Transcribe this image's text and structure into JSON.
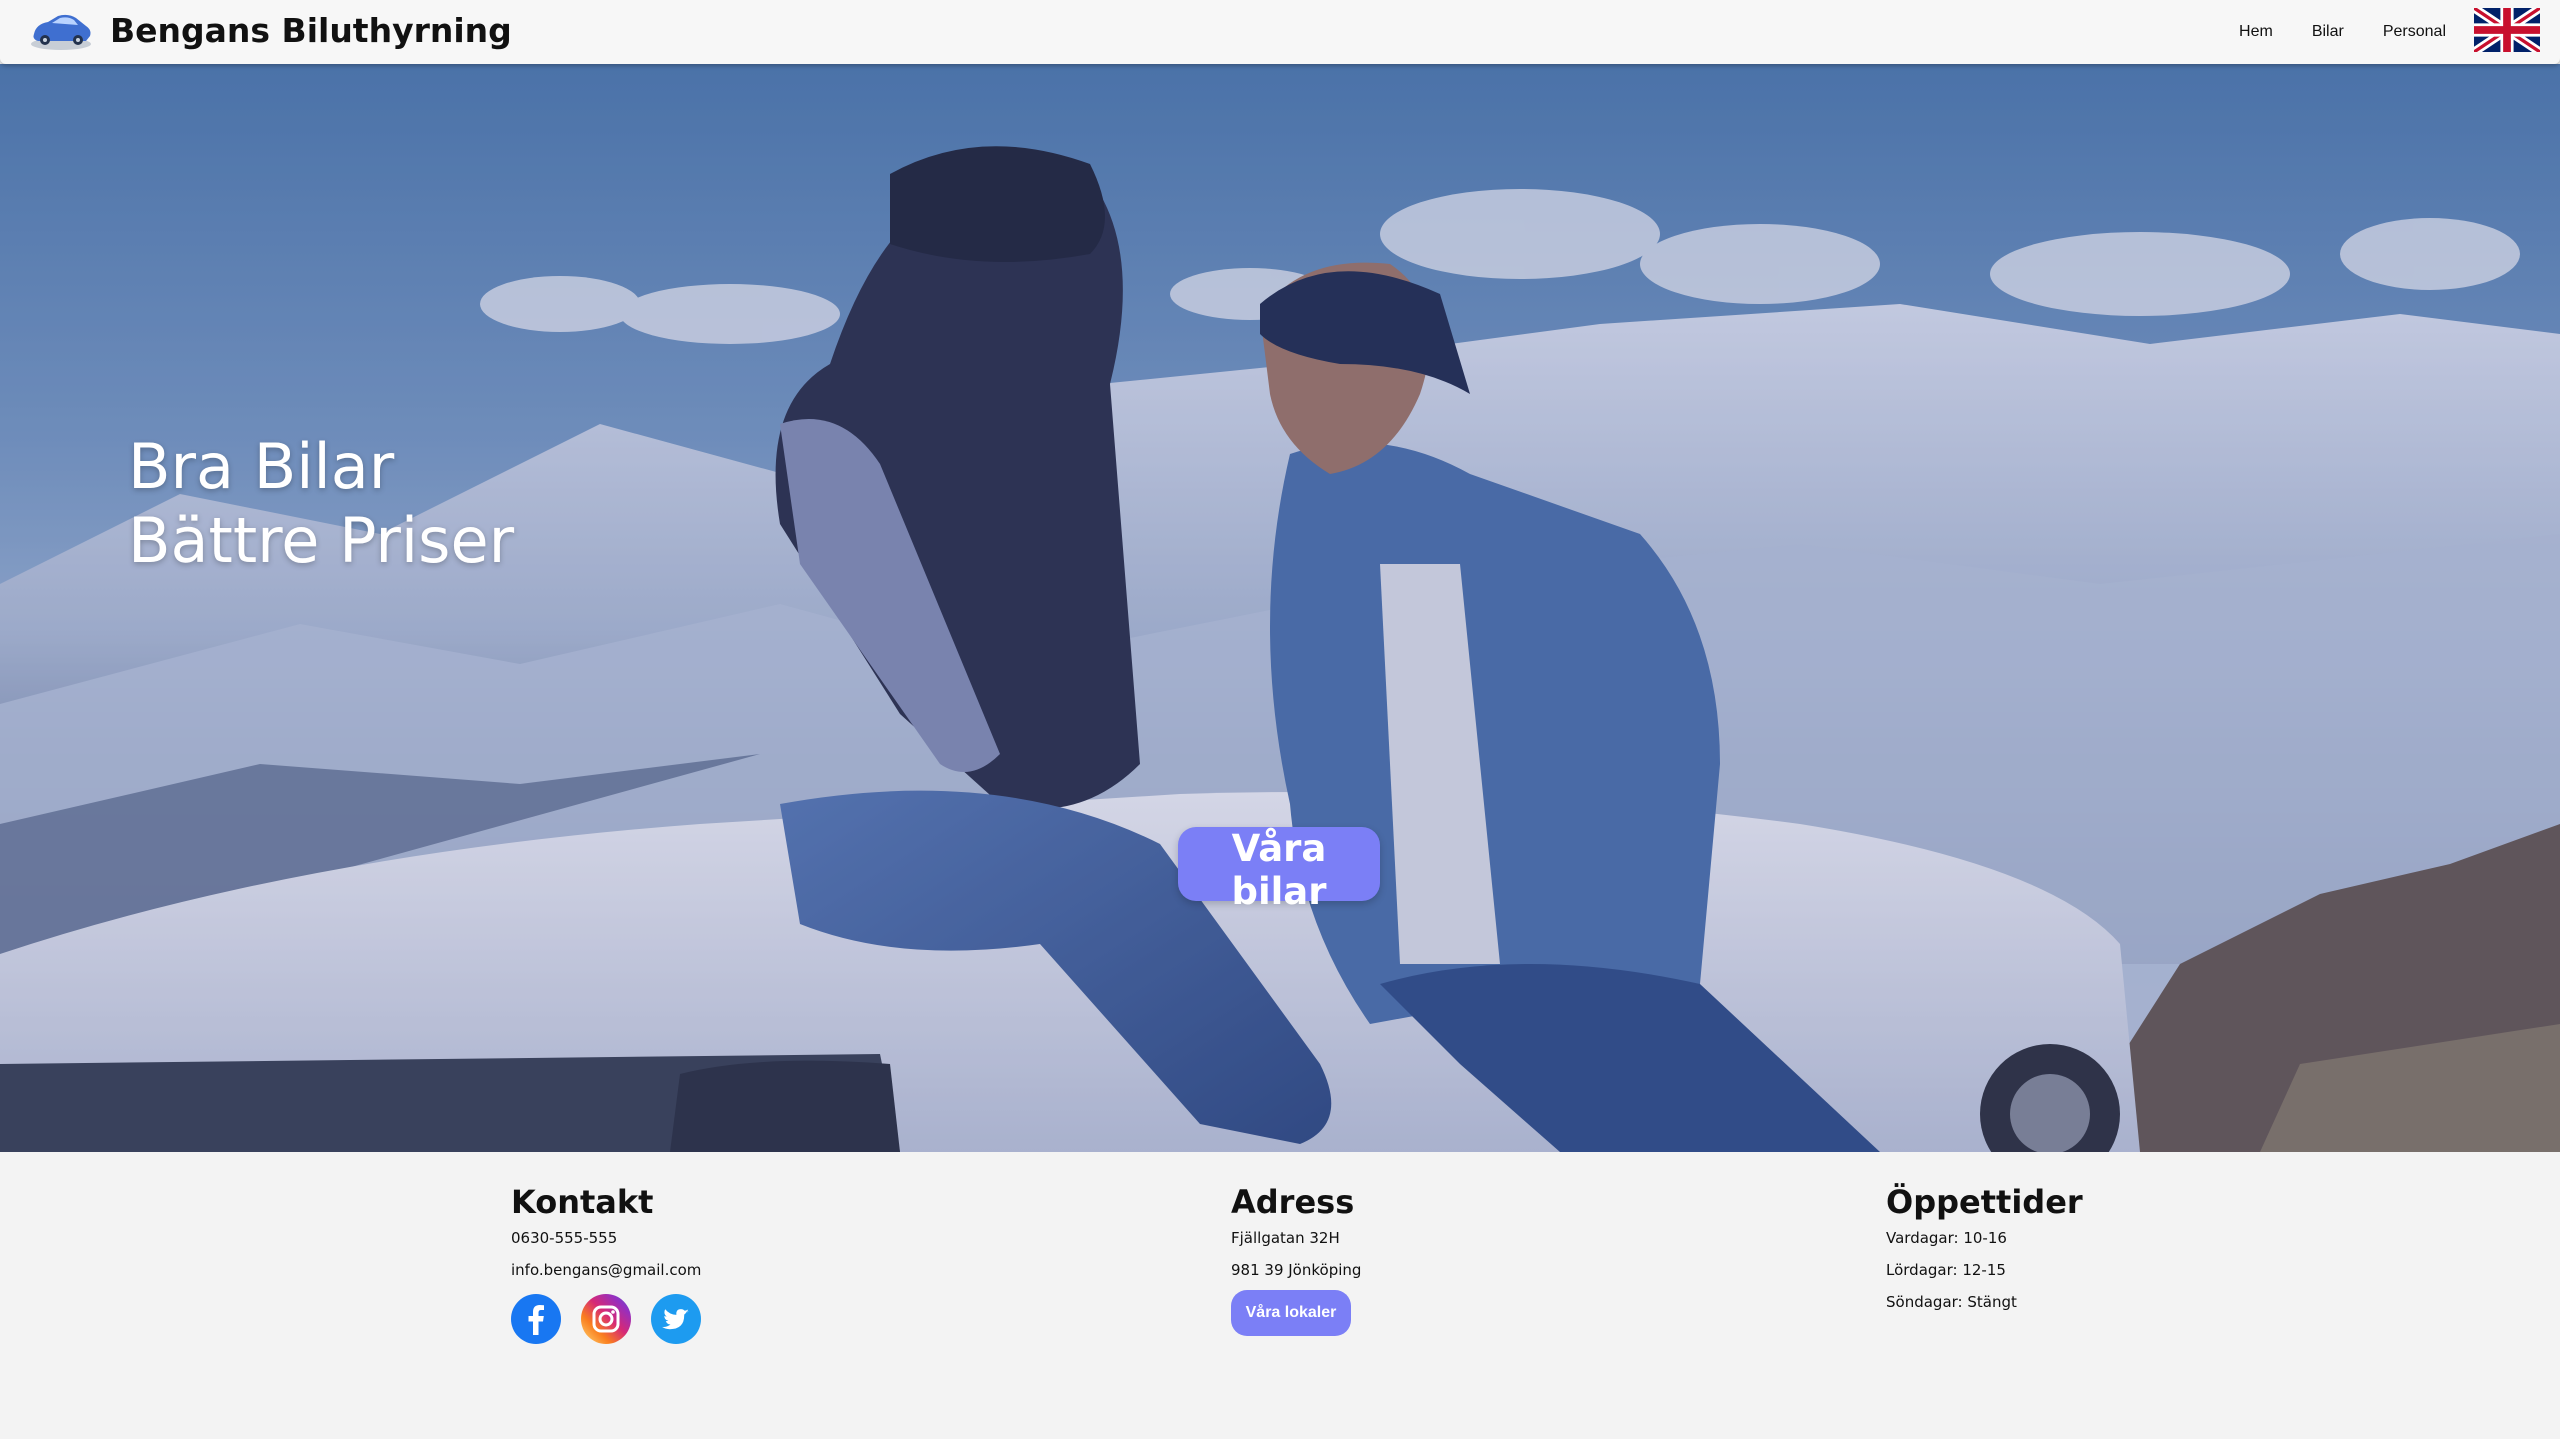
{
  "nav": {
    "brand": "Bengans Biluthyrning",
    "links": [
      "Hem",
      "Bilar",
      "Personal"
    ],
    "language_icon": "uk-flag-icon",
    "logo_icon": "blue-car-icon"
  },
  "hero": {
    "title_line1": "Bra Bilar",
    "title_line2": "Bättre Priser",
    "cta_label": "Våra bilar"
  },
  "footer": {
    "contact": {
      "heading": "Kontakt",
      "phone": "0630-555-555",
      "email": "info.bengans@gmail.com",
      "socials": [
        "facebook-icon",
        "instagram-icon",
        "twitter-icon"
      ]
    },
    "address": {
      "heading": "Adress",
      "street": "Fjällgatan 32H",
      "city": "981 39 Jönköping",
      "button_label": "Våra lokaler"
    },
    "hours": {
      "heading": "Öppettider",
      "weekdays": "Vardagar: 10-16",
      "saturday": "Lördagar: 12-15",
      "sunday": "Söndagar: Stängt"
    }
  },
  "colors": {
    "accent": "#7b7ff6",
    "navbar_bg": "#f7f7f7",
    "footer_bg": "#f3f3f3"
  }
}
